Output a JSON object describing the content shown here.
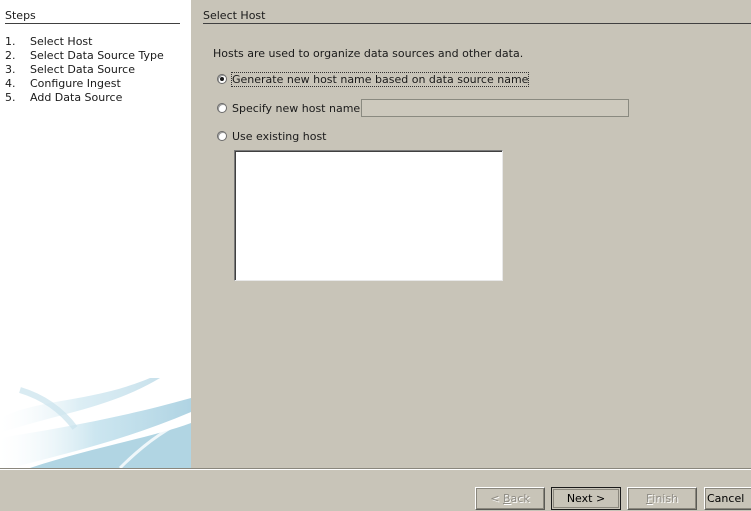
{
  "steps": {
    "title": "Steps",
    "items": [
      {
        "num": "1.",
        "label": "Select Host"
      },
      {
        "num": "2.",
        "label": "Select Data Source Type"
      },
      {
        "num": "3.",
        "label": "Select Data Source"
      },
      {
        "num": "4.",
        "label": "Configure Ingest"
      },
      {
        "num": "5.",
        "label": "Add Data Source"
      }
    ]
  },
  "content": {
    "title": "Select Host",
    "intro": "Hosts are used to organize data sources and other data.",
    "options": {
      "generate": "Generate new host name based on data source name",
      "specify": "Specify new host name",
      "existing": "Use existing host"
    },
    "host_name_value": ""
  },
  "buttons": {
    "back_prefix": "< ",
    "back_mnemonic": "B",
    "back_rest": "ack",
    "next": "Next >",
    "finish_mnemonic": "F",
    "finish_rest": "inish",
    "cancel": "Cancel"
  },
  "colors": {
    "dialog_bg": "#c8c4b8",
    "panel_bg": "#ffffff",
    "swoosh": "#a8d0e0"
  }
}
